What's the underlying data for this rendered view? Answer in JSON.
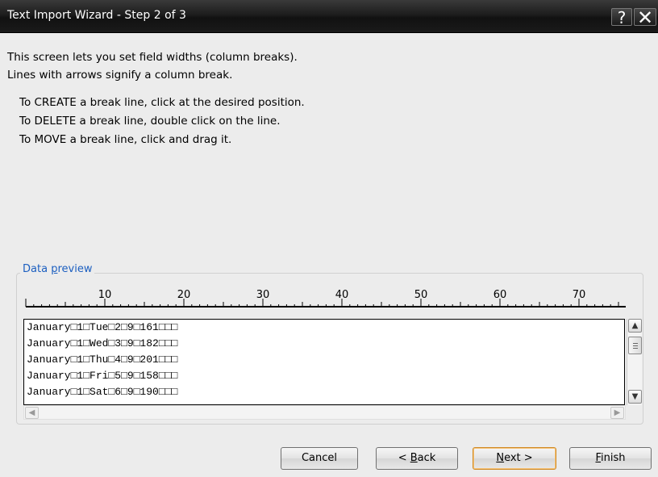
{
  "window": {
    "title": "Text Import Wizard - Step 2 of 3",
    "help_glyph": "?",
    "close_glyph": "✕"
  },
  "instructions": {
    "line1": "This screen lets you set field widths (column breaks).",
    "line2": "Lines with arrows signify a column break.",
    "create": "To CREATE a break line, click at the desired position.",
    "delete": "To DELETE a break line, double click on the line.",
    "move": "To MOVE a break line, click and drag it."
  },
  "data_preview": {
    "label_before": "Data ",
    "label_access": "p",
    "label_after": "review",
    "ruler_ticks": [
      "10",
      "20",
      "30",
      "40",
      "50",
      "60",
      "70"
    ],
    "rows": [
      "January□1□Tue□2□9□161□□□",
      "January□1□Wed□3□9□182□□□",
      "January□1□Thu□4□9□201□□□",
      "January□1□Fri□5□9□158□□□",
      "January□1□Sat□6□9□190□□□"
    ]
  },
  "buttons": {
    "cancel": "Cancel",
    "back_prefix": "< ",
    "back_access": "B",
    "back_rest": "ack",
    "next_access": "N",
    "next_rest": "ext >",
    "finish_access": "F",
    "finish_rest": "inish"
  },
  "icons": {
    "scroll_up": "▲",
    "scroll_down": "▼",
    "scroll_left": "◀",
    "scroll_right": "▶"
  }
}
